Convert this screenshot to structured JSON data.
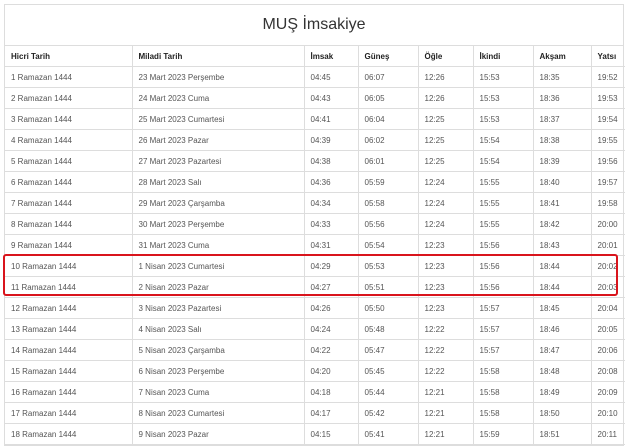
{
  "title": "MUŞ İmsakiye",
  "highlight_color": "#d9141c",
  "columns": [
    "Hicri Tarih",
    "Miladi Tarih",
    "İmsak",
    "Güneş",
    "Öğle",
    "İkindi",
    "Akşam",
    "Yatsı"
  ],
  "rows": [
    [
      "1 Ramazan 1444",
      "23 Mart 2023 Perşembe",
      "04:45",
      "06:07",
      "12:26",
      "15:53",
      "18:35",
      "19:52"
    ],
    [
      "2 Ramazan 1444",
      "24 Mart 2023 Cuma",
      "04:43",
      "06:05",
      "12:26",
      "15:53",
      "18:36",
      "19:53"
    ],
    [
      "3 Ramazan 1444",
      "25 Mart 2023 Cumartesi",
      "04:41",
      "06:04",
      "12:25",
      "15:53",
      "18:37",
      "19:54"
    ],
    [
      "4 Ramazan 1444",
      "26 Mart 2023 Pazar",
      "04:39",
      "06:02",
      "12:25",
      "15:54",
      "18:38",
      "19:55"
    ],
    [
      "5 Ramazan 1444",
      "27 Mart 2023 Pazartesi",
      "04:38",
      "06:01",
      "12:25",
      "15:54",
      "18:39",
      "19:56"
    ],
    [
      "6 Ramazan 1444",
      "28 Mart 2023 Salı",
      "04:36",
      "05:59",
      "12:24",
      "15:55",
      "18:40",
      "19:57"
    ],
    [
      "7 Ramazan 1444",
      "29 Mart 2023 Çarşamba",
      "04:34",
      "05:58",
      "12:24",
      "15:55",
      "18:41",
      "19:58"
    ],
    [
      "8 Ramazan 1444",
      "30 Mart 2023 Perşembe",
      "04:33",
      "05:56",
      "12:24",
      "15:55",
      "18:42",
      "20:00"
    ],
    [
      "9 Ramazan 1444",
      "31 Mart 2023 Cuma",
      "04:31",
      "05:54",
      "12:23",
      "15:56",
      "18:43",
      "20:01"
    ],
    [
      "10 Ramazan 1444",
      "1 Nisan 2023 Cumartesi",
      "04:29",
      "05:53",
      "12:23",
      "15:56",
      "18:44",
      "20:02"
    ],
    [
      "11 Ramazan 1444",
      "2 Nisan 2023 Pazar",
      "04:27",
      "05:51",
      "12:23",
      "15:56",
      "18:44",
      "20:03"
    ],
    [
      "12 Ramazan 1444",
      "3 Nisan 2023 Pazartesi",
      "04:26",
      "05:50",
      "12:23",
      "15:57",
      "18:45",
      "20:04"
    ],
    [
      "13 Ramazan 1444",
      "4 Nisan 2023 Salı",
      "04:24",
      "05:48",
      "12:22",
      "15:57",
      "18:46",
      "20:05"
    ],
    [
      "14 Ramazan 1444",
      "5 Nisan 2023 Çarşamba",
      "04:22",
      "05:47",
      "12:22",
      "15:57",
      "18:47",
      "20:06"
    ],
    [
      "15 Ramazan 1444",
      "6 Nisan 2023 Perşembe",
      "04:20",
      "05:45",
      "12:22",
      "15:58",
      "18:48",
      "20:08"
    ],
    [
      "16 Ramazan 1444",
      "7 Nisan 2023 Cuma",
      "04:18",
      "05:44",
      "12:21",
      "15:58",
      "18:49",
      "20:09"
    ],
    [
      "17 Ramazan 1444",
      "8 Nisan 2023 Cumartesi",
      "04:17",
      "05:42",
      "12:21",
      "15:58",
      "18:50",
      "20:10"
    ],
    [
      "18 Ramazan 1444",
      "9 Nisan 2023 Pazar",
      "04:15",
      "05:41",
      "12:21",
      "15:59",
      "18:51",
      "20:11"
    ]
  ]
}
